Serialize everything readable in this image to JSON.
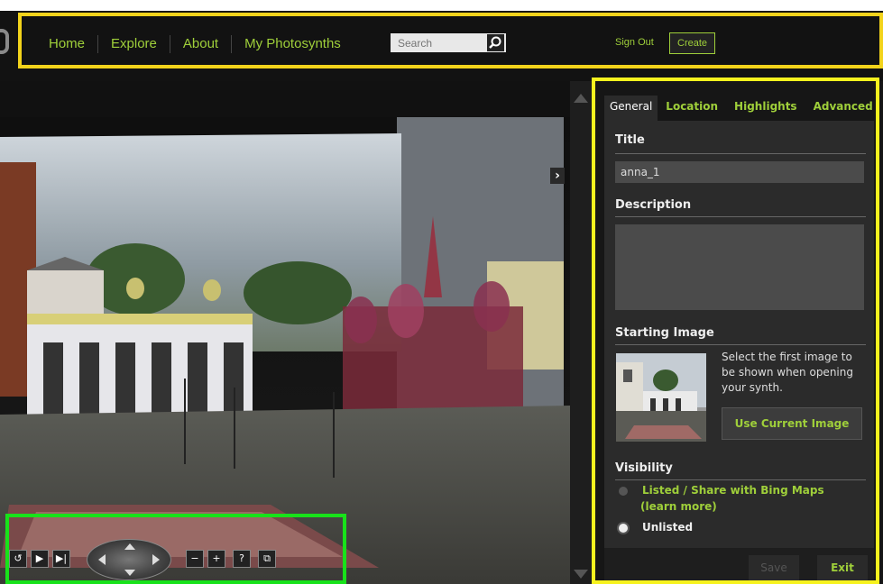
{
  "nav": {
    "items": [
      {
        "label": "Home"
      },
      {
        "label": "Explore"
      },
      {
        "label": "About"
      },
      {
        "label": "My Photosynths"
      }
    ],
    "search_placeholder": "Search",
    "sign_out": "Sign Out",
    "create": "Create"
  },
  "panel": {
    "tabs": [
      {
        "label": "General",
        "active": true
      },
      {
        "label": "Location"
      },
      {
        "label": "Highlights"
      },
      {
        "label": "Advanced"
      }
    ],
    "title_heading": "Title",
    "title_value": "anna_1",
    "description_heading": "Description",
    "description_value": "",
    "starting_image_heading": "Starting Image",
    "starting_image_text": "Select the first image to be shown when opening your synth.",
    "use_current_image": "Use Current Image",
    "visibility_heading": "Visibility",
    "visibility_options": [
      {
        "label": "Listed / Share with Bing Maps",
        "sub": "(learn more)",
        "selected": false
      },
      {
        "label": "Unlisted",
        "selected": true
      }
    ],
    "save": "Save",
    "exit": "Exit"
  },
  "colors": {
    "accent": "#9fcf3a",
    "highlight_yellow": "#f6f21e",
    "highlight_green": "#18e21a"
  }
}
